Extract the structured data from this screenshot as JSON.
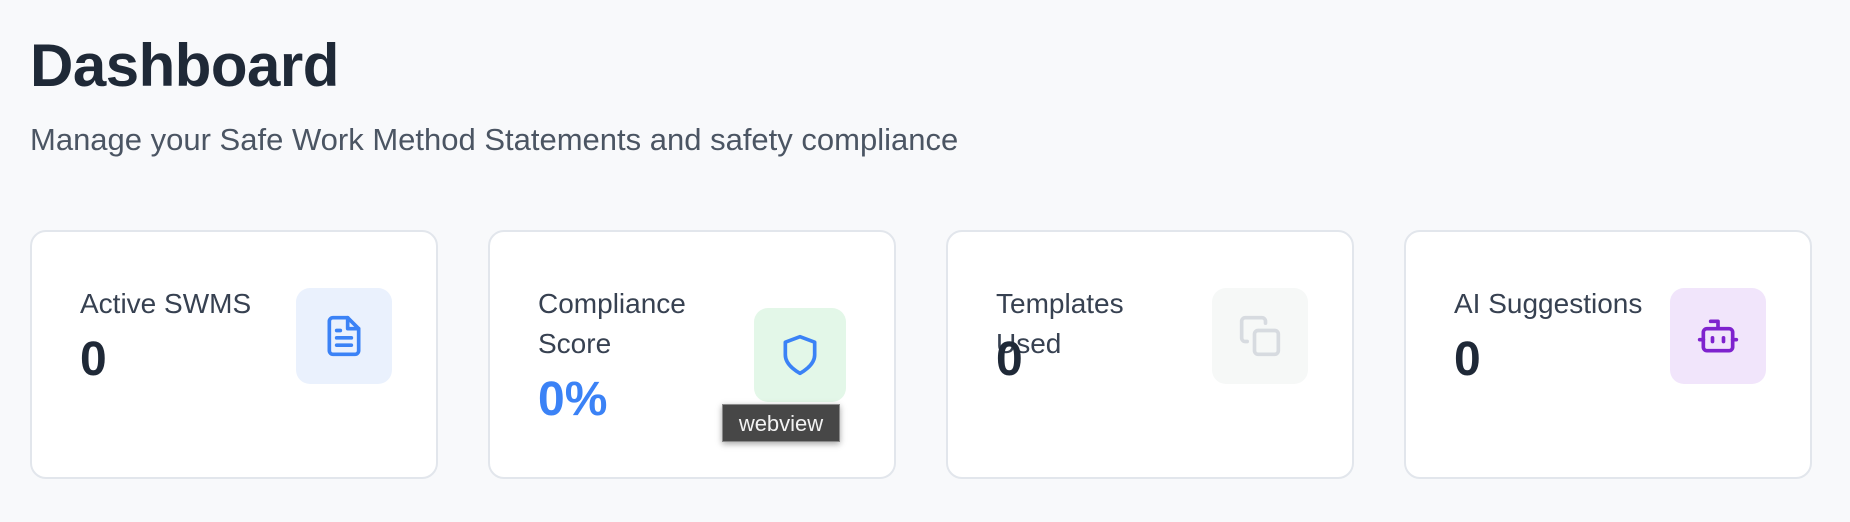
{
  "header": {
    "title": "Dashboard",
    "subtitle": "Manage your Safe Work Method Statements and safety compliance"
  },
  "stats": [
    {
      "label": "Active SWMS",
      "value": "0",
      "icon": "document-icon",
      "icon_color": "#3b82f6",
      "icon_bg": "#eaf1fd"
    },
    {
      "label": "Compliance Score",
      "value": "0%",
      "icon": "shield-icon",
      "icon_color": "#3b82f6",
      "icon_bg": "#e3f7e8",
      "value_color": "#3b82f6"
    },
    {
      "label": "Templates Used",
      "value": "0",
      "icon": "copy-icon",
      "icon_color": "#d7dbe0",
      "icon_bg": "#f6f8f7"
    },
    {
      "label": "AI Suggestions",
      "value": "0",
      "icon": "robot-icon",
      "icon_color": "#7e22ce",
      "icon_bg": "#f1e5fb"
    }
  ],
  "tooltip": {
    "text": "webview"
  },
  "colors": {
    "background": "#f8f9fb",
    "card_border": "#e2e6ec",
    "heading": "#1f2937",
    "subtext": "#4b5563"
  }
}
